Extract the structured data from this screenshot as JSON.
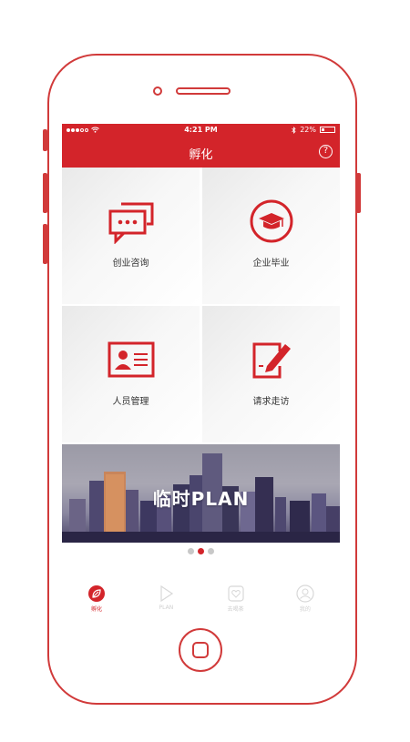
{
  "status": {
    "time": "4:21 PM",
    "battery": "22%",
    "battery_level": 0.22
  },
  "navbar": {
    "title": "孵化",
    "help_icon": "?"
  },
  "tiles": [
    {
      "label": "创业咨询",
      "icon": "chat-bubbles-icon"
    },
    {
      "label": "企业毕业",
      "icon": "graduation-cap-icon"
    },
    {
      "label": "人员管理",
      "icon": "id-card-icon"
    },
    {
      "label": "请求走访",
      "icon": "edit-note-icon"
    }
  ],
  "banner": {
    "title": "临时PLAN",
    "pages": 3,
    "active_page": 2
  },
  "tabbar": {
    "items": [
      {
        "label": "孵化",
        "icon": "leaf-icon",
        "active": true
      },
      {
        "label": "PLAN",
        "icon": "play-icon",
        "active": false
      },
      {
        "label": "去喝茶",
        "icon": "heart-icon",
        "active": false
      },
      {
        "label": "我的",
        "icon": "user-icon",
        "active": false
      }
    ]
  },
  "colors": {
    "accent": "#d3242a",
    "frame": "#d13a3a"
  }
}
